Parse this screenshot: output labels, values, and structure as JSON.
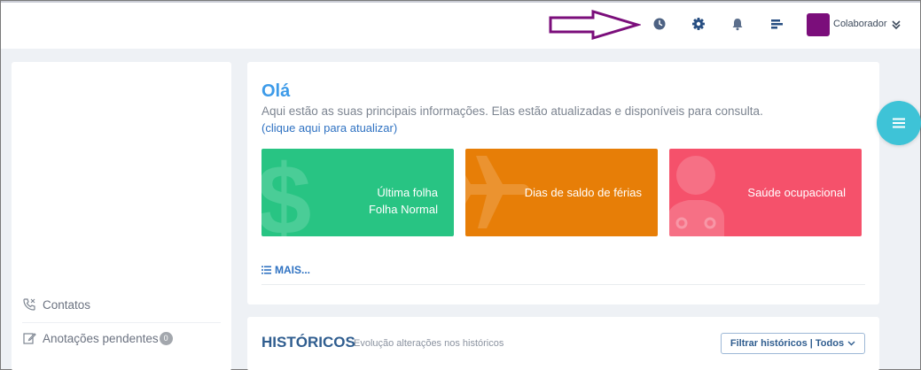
{
  "header": {
    "user_label": "Colaborador",
    "icons": [
      "clock-icon",
      "gear-icon",
      "bell-icon",
      "menu-bars-icon",
      "chevron-double-down-icon"
    ],
    "annotation_arrow_color": "#7b0e7b",
    "avatar_color": "#7b0e7b"
  },
  "sidebar": {
    "items": [
      {
        "label": "Contatos",
        "icon": "phone-icon"
      },
      {
        "label": "Anotações pendentes",
        "icon": "edit-icon",
        "badge": "0"
      }
    ]
  },
  "welcome": {
    "greeting": "Olá",
    "info_text": "Aqui estão as suas principais informações. Elas estão atualizadas e disponíveis para consulta.",
    "refresh_link": "(clique aqui para atualizar)",
    "tiles": [
      {
        "line1": "Última folha",
        "line2": "Folha Normal",
        "color": "#28c483",
        "icon": "dollar-icon"
      },
      {
        "line1": "Dias de saldo de férias",
        "color": "#e77e07",
        "icon": "airplane-icon"
      },
      {
        "line1": "Saúde ocupacional",
        "color": "#f5516b",
        "icon": "doctor-icon"
      }
    ],
    "more_link": "MAIS..."
  },
  "history": {
    "title": "HISTÓRICOS",
    "subtitle": "Evolução alterações nos históricos",
    "filter_label": "Filtrar históricos | Todos"
  },
  "colors": {
    "accent_blue": "#3d9be9",
    "link_blue": "#2f72c2",
    "fab_cyan": "#3ec3d7"
  }
}
